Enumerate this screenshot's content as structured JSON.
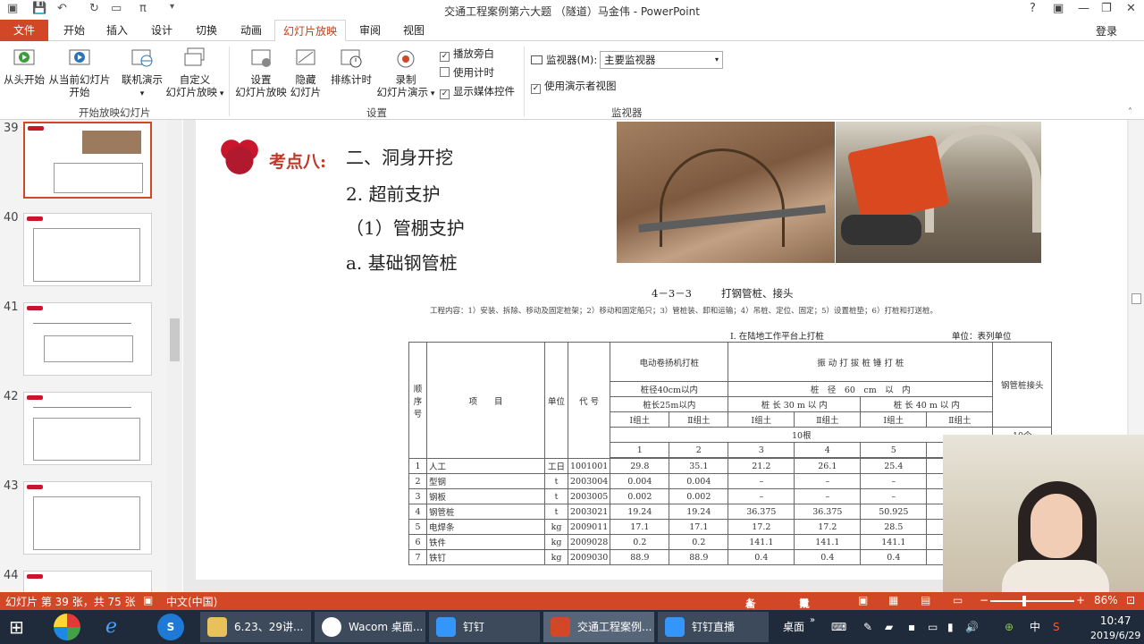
{
  "window": {
    "title": "交通工程案例第六大题 （隧道）马金伟 - PowerPoint"
  },
  "tabs": {
    "file": "文件",
    "home": "开始",
    "insert": "插入",
    "design": "设计",
    "transitions": "切换",
    "animations": "动画",
    "slideshow": "幻灯片放映",
    "review": "审阅",
    "view": "视图",
    "login": "登录"
  },
  "ribbon": {
    "from_begin": "从头开始",
    "from_current_1": "从当前幻灯片",
    "from_current_2": "开始",
    "online": "联机演示",
    "custom_1": "自定义",
    "custom_2": "幻灯片放映",
    "group_start": "开始放映幻灯片",
    "setup_1": "设置",
    "setup_2": "幻灯片放映",
    "hide_1": "隐藏",
    "hide_2": "幻灯片",
    "rehearse": "排练计时",
    "record_1": "录制",
    "record_2": "幻灯片演示",
    "chk_narration": "播放旁白",
    "chk_timing": "使用计时",
    "chk_media": "显示媒体控件",
    "group_setup": "设置",
    "monitor_label": "监视器(M):",
    "monitor_value": "主要监视器",
    "presenter_view": "使用演示者视图",
    "group_monitor": "监视器"
  },
  "slides": [
    {
      "num": "39",
      "selected": true
    },
    {
      "num": "40"
    },
    {
      "num": "41"
    },
    {
      "num": "42"
    },
    {
      "num": "43"
    },
    {
      "num": "44"
    }
  ],
  "slide": {
    "tag": "考点八:",
    "line1": "二、洞身开挖",
    "line2": "2. 超前支护",
    "line3": "（1）管棚支护",
    "line4": "a. 基础钢管桩",
    "table_title_code": "4－3－3",
    "table_title": "打钢管桩、接头",
    "work_content": "工程内容：1）安装、拆除、移动及固定桩架；2）移动和固定船只；3）管桩装、卸和运输；4）吊桩、定位、固定；5）设置桩垫；6）打桩和打送桩。",
    "section": "Ⅰ. 在陆地工作平台上打桩",
    "unit": "单位：表列单位",
    "h_seq": "顺序号",
    "h_item": "项　　目",
    "h_unit": "单位",
    "h_code": "代 号",
    "h_winch": "电动卷扬机打桩",
    "h_vib": "振 动 打 拔 桩 锤 打 桩",
    "h_joint": "钢管桩接头",
    "h_d40": "桩径40cm以内",
    "h_d60": "桩　径　60　cm　以　内",
    "h_l25": "桩长25m以内",
    "h_l30": "桩 长 30 m 以 内",
    "h_l40": "桩 长 40 m 以 内",
    "soil1": "Ⅰ组土",
    "soil2": "Ⅱ组土",
    "per10": "10根",
    "per10b": "10个",
    "cols": [
      "1",
      "2",
      "3",
      "4",
      "5"
    ],
    "rows": [
      {
        "n": "1",
        "item": "人工",
        "unit": "工日",
        "code": "1001001",
        "v": [
          "29.8",
          "35.1",
          "21.2",
          "26.1",
          "25.4"
        ]
      },
      {
        "n": "2",
        "item": "型钢",
        "unit": "t",
        "code": "2003004",
        "v": [
          "0.004",
          "0.004",
          "–",
          "–",
          "–"
        ]
      },
      {
        "n": "3",
        "item": "钢板",
        "unit": "t",
        "code": "2003005",
        "v": [
          "0.002",
          "0.002",
          "–",
          "–",
          "–"
        ]
      },
      {
        "n": "4",
        "item": "钢管桩",
        "unit": "t",
        "code": "2003021",
        "v": [
          "19.24",
          "19.24",
          "36.375",
          "36.375",
          "50.925"
        ]
      },
      {
        "n": "5",
        "item": "电焊条",
        "unit": "kg",
        "code": "2009011",
        "v": [
          "17.1",
          "17.1",
          "17.2",
          "17.2",
          "28.5"
        ]
      },
      {
        "n": "6",
        "item": "铁件",
        "unit": "kg",
        "code": "2009028",
        "v": [
          "0.2",
          "0.2",
          "141.1",
          "141.1",
          "141.1"
        ]
      },
      {
        "n": "7",
        "item": "铁钉",
        "unit": "kg",
        "code": "2009030",
        "v": [
          "88.9",
          "88.9",
          "0.4",
          "0.4",
          "0.4"
        ]
      }
    ]
  },
  "status": {
    "slide_info": "幻灯片 第 39 张，共 75 张",
    "lang": "中文(中国)",
    "notes": "备注",
    "comments": "批注",
    "zoom": "86%"
  },
  "taskbar": {
    "item1": "6.23、29讲...",
    "item2": "Wacom 桌面...",
    "item3": "钉钉",
    "item4": "交通工程案例...",
    "item5": "钉钉直播",
    "desktop": "桌面",
    "ime": "中",
    "time": "10:47",
    "date": "2019/6/29"
  }
}
